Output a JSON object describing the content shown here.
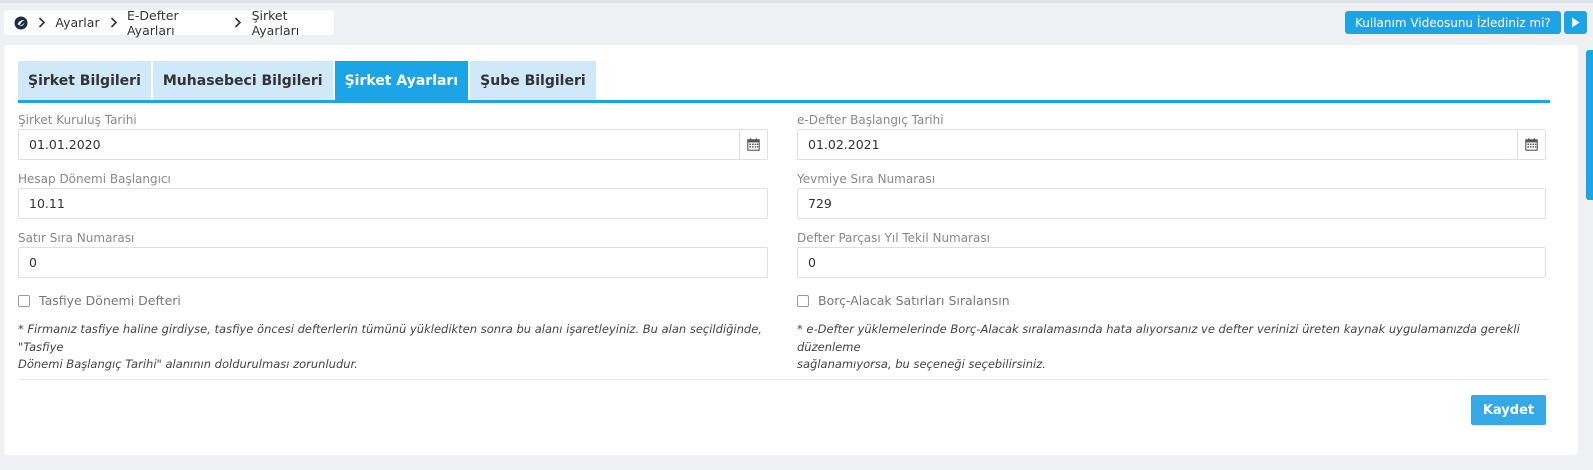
{
  "breadcrumb": {
    "home_icon": "home-logo-icon",
    "items": [
      "Ayarlar",
      "E-Defter Ayarları",
      "Şirket Ayarları"
    ]
  },
  "video_button": {
    "label": "Kullanım Videosunu İzlediniz mi?",
    "icon": "play-icon"
  },
  "tabs": [
    {
      "label": "Şirket Bilgileri",
      "active": false
    },
    {
      "label": "Muhasebeci Bilgileri",
      "active": false
    },
    {
      "label": "Şirket Ayarları",
      "active": true
    },
    {
      "label": "Şube Bilgileri",
      "active": false
    }
  ],
  "form": {
    "kurulus_tarihi": {
      "label": "Şirket Kuruluş Tarihi",
      "value": "01.01.2020",
      "icon": "calendar-icon"
    },
    "edefter_baslangic": {
      "label": "e-Defter Başlangıç Tarihi",
      "value": "01.02.2021",
      "icon": "calendar-icon"
    },
    "hesap_donemi": {
      "label": "Hesap Dönemi Başlangıcı",
      "value": "10.11"
    },
    "yevmiye_sira": {
      "label": "Yevmiye Sıra Numarası",
      "value": "729"
    },
    "satir_sira": {
      "label": "Satır Sıra Numarası",
      "value": "0"
    },
    "defter_parcasi": {
      "label": "Defter Parçası Yıl Tekil Numarası",
      "value": "0"
    },
    "tasfiye": {
      "label": "Tasfiye Dönemi Defteri",
      "checked": false,
      "note_line1": "* Firmanız tasfiye haline girdiyse, tasfiye öncesi defterlerin tümünü yükledikten sonra bu alanı işaretleyiniz. Bu alan seçildiğinde, \"Tasfiye",
      "note_line2": "Dönemi Başlangıç Tarihi\" alanının doldurulması zorunludur."
    },
    "borc_alacak": {
      "label": "Borç-Alacak Satırları Sıralansın",
      "checked": false,
      "note_line1": "* e-Defter yüklemelerinde Borç-Alacak sıralamasında hata alıyorsanız ve defter verinizi üreten kaynak uygulamanızda gerekli düzenleme",
      "note_line2": "sağlanamıyorsa, bu seçeneği seçebilirsiniz."
    }
  },
  "save_button": {
    "label": "Kaydet"
  },
  "colors": {
    "accent": "#1ba5e6",
    "tab_inactive": "#cfe9f8",
    "background": "#eef0f3"
  }
}
